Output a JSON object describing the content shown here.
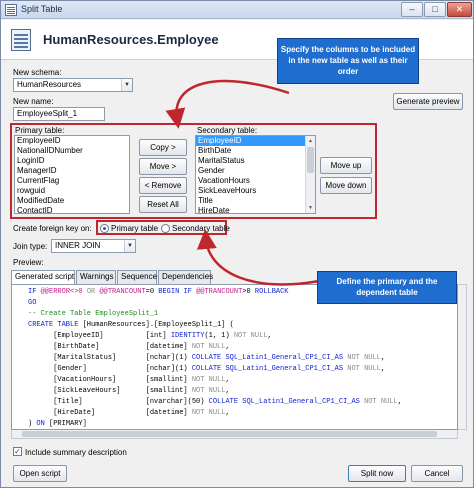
{
  "window": {
    "title": "Split Table",
    "minimize": "–",
    "maximize": "□",
    "close": "✕"
  },
  "header": {
    "title": "HumanResources.Employee",
    "icon": "table-icon"
  },
  "schema": {
    "label": "New schema:",
    "value": "HumanResources"
  },
  "name": {
    "label": "New name:",
    "value": "EmployeeSplit_1"
  },
  "generate_preview": "Generate preview",
  "primary_table": {
    "label": "Primary table:",
    "items": [
      "EmployeeID",
      "NationalIDNumber",
      "LoginID",
      "ManagerID",
      "CurrentFlag",
      "rowguid",
      "ModifiedDate",
      "ContactID",
      "SalariedFlag"
    ]
  },
  "secondary_table": {
    "label": "Secondary table:",
    "items": [
      "EmployeeID",
      "BirthDate",
      "MaritalStatus",
      "Gender",
      "VacationHours",
      "SickLeaveHours",
      "Title",
      "HireDate"
    ],
    "selected_index": 0
  },
  "move_buttons": {
    "copy": "Copy >",
    "move": "Move >",
    "remove": "< Remove",
    "reset": "Reset All"
  },
  "order_buttons": {
    "up": "Move up",
    "down": "Move down"
  },
  "foreign_key": {
    "label": "Create foreign key on:",
    "primary": "Primary table",
    "secondary": "Secondary table",
    "selected": "primary"
  },
  "join": {
    "label": "Join type:",
    "value": "INNER JOIN"
  },
  "preview_label": "Preview:",
  "tabs": [
    "Generated script",
    "Warnings",
    "Sequence",
    "Dependencies"
  ],
  "script_lines": [
    [
      {
        "t": "IF ",
        "c": "kw"
      },
      {
        "t": "@@ERROR<>0 ",
        "c": "pk"
      },
      {
        "t": "OR ",
        "c": "gr"
      },
      {
        "t": "@@TRANCOUNT",
        "c": "pk"
      },
      {
        "t": "=0 ",
        "c": ""
      },
      {
        "t": "BEGIN IF ",
        "c": "kw"
      },
      {
        "t": "@@TRANCOUNT",
        "c": "pk"
      },
      {
        "t": ">0 ",
        "c": ""
      },
      {
        "t": "ROLLBACK",
        "c": "kw"
      }
    ],
    [
      {
        "t": "GO",
        "c": "kw"
      }
    ],
    [
      {
        "t": "-- Create Table EmployeeSplit_1",
        "c": "cm"
      }
    ],
    [
      {
        "t": "CREATE TABLE ",
        "c": "kw"
      },
      {
        "t": "[HumanResources].[EmployeeSplit_1] (",
        "c": ""
      }
    ],
    [
      {
        "t": "      [EmployeeID]          ",
        "c": ""
      },
      {
        "t": "[int] ",
        "c": ""
      },
      {
        "t": "IDENTITY",
        "c": "kw"
      },
      {
        "t": "(1, 1) ",
        "c": ""
      },
      {
        "t": "NOT NULL",
        "c": "gr"
      },
      {
        "t": ",",
        "c": ""
      }
    ],
    [
      {
        "t": "      [BirthDate]           ",
        "c": ""
      },
      {
        "t": "[datetime] ",
        "c": ""
      },
      {
        "t": "NOT NULL",
        "c": "gr"
      },
      {
        "t": ",",
        "c": ""
      }
    ],
    [
      {
        "t": "      [MaritalStatus]       ",
        "c": ""
      },
      {
        "t": "[nchar](1) ",
        "c": ""
      },
      {
        "t": "COLLATE ",
        "c": "kw"
      },
      {
        "t": "SQL_Latin1_General_CP1_CI_AS ",
        "c": "kw"
      },
      {
        "t": "NOT NULL",
        "c": "gr"
      },
      {
        "t": ",",
        "c": ""
      }
    ],
    [
      {
        "t": "      [Gender]              ",
        "c": ""
      },
      {
        "t": "[nchar](1) ",
        "c": ""
      },
      {
        "t": "COLLATE ",
        "c": "kw"
      },
      {
        "t": "SQL_Latin1_General_CP1_CI_AS ",
        "c": "kw"
      },
      {
        "t": "NOT NULL",
        "c": "gr"
      },
      {
        "t": ",",
        "c": ""
      }
    ],
    [
      {
        "t": "      [VacationHours]       ",
        "c": ""
      },
      {
        "t": "[smallint] ",
        "c": ""
      },
      {
        "t": "NOT NULL",
        "c": "gr"
      },
      {
        "t": ",",
        "c": ""
      }
    ],
    [
      {
        "t": "      [SickLeaveHours]      ",
        "c": ""
      },
      {
        "t": "[smallint] ",
        "c": ""
      },
      {
        "t": "NOT NULL",
        "c": "gr"
      },
      {
        "t": ",",
        "c": ""
      }
    ],
    [
      {
        "t": "      [Title]               ",
        "c": ""
      },
      {
        "t": "[nvarchar](50) ",
        "c": ""
      },
      {
        "t": "COLLATE ",
        "c": "kw"
      },
      {
        "t": "SQL_Latin1_General_CP1_CI_AS ",
        "c": "kw"
      },
      {
        "t": "NOT NULL",
        "c": "gr"
      },
      {
        "t": ",",
        "c": ""
      }
    ],
    [
      {
        "t": "      [HireDate]            ",
        "c": ""
      },
      {
        "t": "[datetime] ",
        "c": ""
      },
      {
        "t": "NOT NULL",
        "c": "gr"
      },
      {
        "t": ",",
        "c": ""
      }
    ],
    [
      {
        "t": ") ",
        "c": ""
      },
      {
        "t": "ON ",
        "c": "kw"
      },
      {
        "t": "[PRIMARY]",
        "c": ""
      }
    ]
  ],
  "include_summary": {
    "label": "Include summary description",
    "checked": true
  },
  "footer": {
    "open_script": "Open script",
    "split_now": "Split now",
    "cancel": "Cancel"
  },
  "callouts": {
    "top": "Specify the columns to be included in the new table as well as their order",
    "bottom": "Define the primary and the dependent table"
  },
  "colors": {
    "callout": "#1e6dcf",
    "highlight_border": "#c0262e",
    "selection": "#3399ff"
  }
}
